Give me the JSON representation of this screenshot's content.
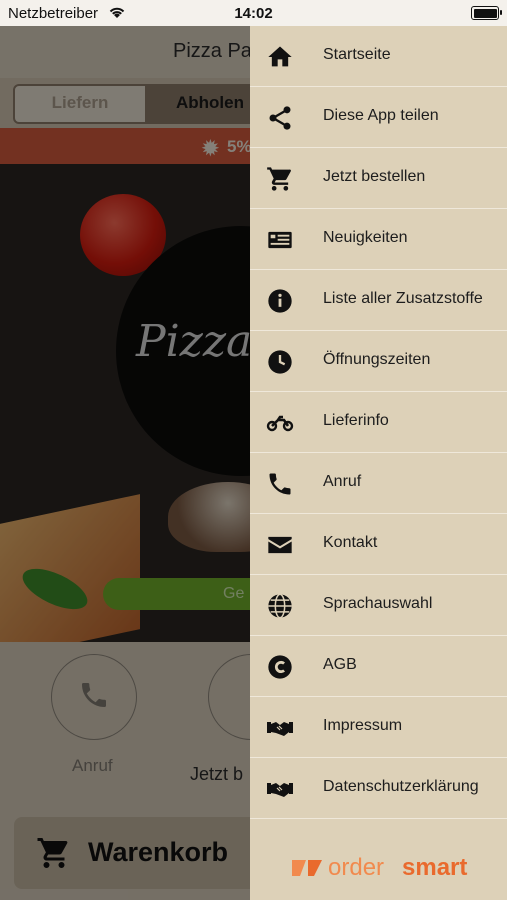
{
  "status_bar": {
    "carrier": "Netzbetreiber",
    "time": "14:02"
  },
  "header": {
    "title": "Pizza Pa"
  },
  "order_mode": {
    "delivery": "Liefern",
    "pickup": "Abholen",
    "selected": "Abholen"
  },
  "promo": {
    "text": "5%"
  },
  "hero": {
    "logo_text": "Pizza",
    "green_button": "Ge"
  },
  "actions": {
    "call": "Anruf",
    "order": "Jetzt b"
  },
  "cart_button": {
    "label": "Warenkorb"
  },
  "drawer": {
    "items": [
      {
        "label": "Startseite",
        "icon": "home-icon"
      },
      {
        "label": "Diese App teilen",
        "icon": "share-icon"
      },
      {
        "label": "Jetzt bestellen",
        "icon": "cart-icon"
      },
      {
        "label": "Neuigkeiten",
        "icon": "news-icon"
      },
      {
        "label": "Liste aller Zusatzstoffe",
        "icon": "info-icon"
      },
      {
        "label": "Öffnungszeiten",
        "icon": "clock-icon"
      },
      {
        "label": "Lieferinfo",
        "icon": "motorcycle-icon"
      },
      {
        "label": "Anruf",
        "icon": "phone-icon"
      },
      {
        "label": "Kontakt",
        "icon": "envelope-icon"
      },
      {
        "label": "Sprachauswahl",
        "icon": "globe-icon"
      },
      {
        "label": "AGB",
        "icon": "copyright-icon"
      },
      {
        "label": "Impressum",
        "icon": "handshake-icon"
      },
      {
        "label": "Datenschutzerklärung",
        "icon": "handshake-icon"
      }
    ]
  },
  "footer": {
    "brand_part1": "order",
    "brand_part2": "smart"
  },
  "colors": {
    "drawer_bg": "#ddd1b8",
    "promo_bar": "#d25a3c",
    "brand_orange": "#e96a2d",
    "green_button": "#6fae2a"
  }
}
